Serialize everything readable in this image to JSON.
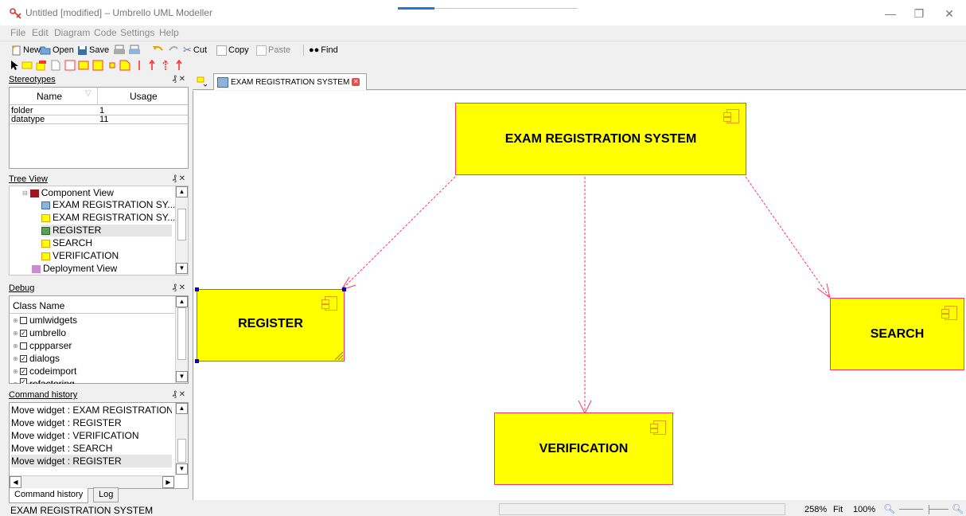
{
  "window": {
    "title": "Untitled [modified] – Umbrello UML Modeller"
  },
  "menu": [
    "File",
    "Edit",
    "Diagram",
    "Code",
    "Settings",
    "Help"
  ],
  "toolbar": {
    "new": "New",
    "open": "Open",
    "save": "Save",
    "cut": "Cut",
    "copy": "Copy",
    "paste": "Paste",
    "find": "Find"
  },
  "stereotypes": {
    "title": "Stereotypes",
    "columns": [
      "Name",
      "Usage"
    ],
    "rows": [
      {
        "name": "folder",
        "usage": "1"
      },
      {
        "name": "datatype",
        "usage": "11"
      }
    ]
  },
  "tree": {
    "title": "Tree View",
    "items": [
      "Component View",
      "EXAM REGISTRATION SY...",
      "EXAM REGISTRATION SY...",
      "REGISTER",
      "SEARCH",
      "VERIFICATION",
      "Deployment View"
    ]
  },
  "debug": {
    "title": "Debug",
    "column": "Class Name",
    "items": [
      {
        "name": "umlwidgets",
        "checked": ""
      },
      {
        "name": "umbrello",
        "checked": "✓"
      },
      {
        "name": "cppparser",
        "checked": ""
      },
      {
        "name": "dialogs",
        "checked": "✓"
      },
      {
        "name": "codeimport",
        "checked": "✓"
      },
      {
        "name": "refactoring",
        "checked": "✓"
      }
    ]
  },
  "command_history": {
    "title": "Command history",
    "items": [
      "Move widget : EXAM REGISTRATION S",
      "Move widget : REGISTER",
      "Move widget : VERIFICATION",
      "Move widget : SEARCH",
      "Move widget : REGISTER"
    ],
    "tabs": [
      "Command history",
      "Log"
    ]
  },
  "diagram": {
    "tab_label": "EXAM REGISTRATION SYSTEM",
    "components": {
      "main": "EXAM REGISTRATION SYSTEM",
      "register": "REGISTER",
      "search": "SEARCH",
      "verification": "VERIFICATION"
    }
  },
  "status": {
    "left": "EXAM REGISTRATION SYSTEM",
    "zoom_pct": "258%",
    "fit": "Fit",
    "hundred": "100%"
  },
  "colors": {
    "component_fill": "#ffff00",
    "component_border": "#ff3366",
    "arrow": "#ff3366"
  }
}
